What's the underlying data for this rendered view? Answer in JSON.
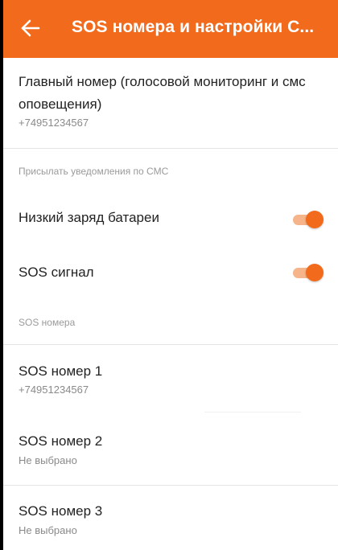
{
  "app_bar": {
    "title": "SOS номера и настройки С...",
    "back_icon": "arrow-left-icon",
    "color": "#f26b1d"
  },
  "main_number": {
    "title_line1": "Главный номер (голосовой мониторинг и смс",
    "title_line2": "оповещения)",
    "value": "+74951234567"
  },
  "sms_section": {
    "header": "Присылать уведомления по СМС",
    "items": [
      {
        "label": "Низкий заряд батареи",
        "enabled": true
      },
      {
        "label": "SOS сигнал",
        "enabled": true
      }
    ]
  },
  "sos_section": {
    "header": "SOS номера",
    "items": [
      {
        "label": "SOS номер 1",
        "value": "+74951234567"
      },
      {
        "label": "SOS номер 2",
        "value": "Не выбрано"
      },
      {
        "label": "SOS номер 3",
        "value": "Не выбрано"
      }
    ]
  },
  "colors": {
    "accent": "#f26b1d",
    "toggle_track": "#f6b48a",
    "secondary_text": "#8a8a8a"
  }
}
